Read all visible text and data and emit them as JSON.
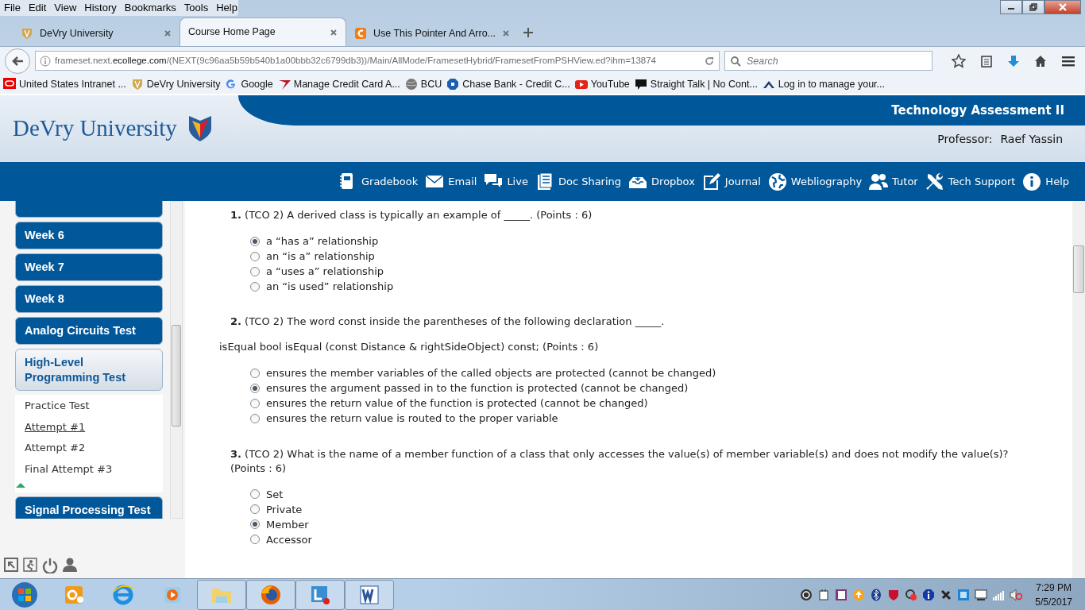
{
  "menu_bar": [
    "File",
    "Edit",
    "View",
    "History",
    "Bookmarks",
    "Tools",
    "Help"
  ],
  "tabs": [
    {
      "label": "DeVry University",
      "selected": false,
      "kind": "shield"
    },
    {
      "label": "Course Home Page",
      "selected": true,
      "kind": "none"
    },
    {
      "label": "Use This Pointer And Arro...",
      "selected": false,
      "kind": "orange"
    }
  ],
  "address": "frameset.next.**ecollege.com**/(NEXT(9c96aa5b59b540b1a00bbb32c6799db3))/Main/AllMode/FramesetHybrid/FramesetFromPSHView.ed?ihm=13874",
  "search": {
    "placeholder": "Search"
  },
  "bookmarks": [
    {
      "label": "United States Intranet ...",
      "kind": "oracle"
    },
    {
      "label": "DeVry University",
      "kind": "shield"
    },
    {
      "label": "Google",
      "kind": "google"
    },
    {
      "label": "Manage Credit Card A...",
      "kind": "swoosh"
    },
    {
      "label": "BCU",
      "kind": "globe"
    },
    {
      "label": "Chase Bank - Credit C...",
      "kind": "chase"
    },
    {
      "label": "YouTube",
      "kind": "youtube"
    },
    {
      "label": "Straight Talk | No Cont...",
      "kind": "bubble"
    },
    {
      "label": "Log in to manage your...",
      "kind": "roof"
    }
  ],
  "site": {
    "logo": "DeVry University",
    "course_title": "Technology Assessment II",
    "professor_label": "Professor:",
    "professor_name": "Raef Yassin"
  },
  "nav_links": [
    {
      "label": "Gradebook",
      "kind": "book"
    },
    {
      "label": "Email",
      "kind": "mail"
    },
    {
      "label": "Live",
      "kind": "chat"
    },
    {
      "label": "Doc Sharing",
      "kind": "doc"
    },
    {
      "label": "Dropbox",
      "kind": "dropbox"
    },
    {
      "label": "Journal",
      "kind": "journal"
    },
    {
      "label": "Webliography",
      "kind": "globe"
    },
    {
      "label": "Tutor",
      "kind": "people"
    },
    {
      "label": "Tech Support",
      "kind": "tools"
    },
    {
      "label": "Help",
      "kind": "info"
    }
  ],
  "sidebar": {
    "items": [
      {
        "label": "Week 6",
        "expanded": false
      },
      {
        "label": "Week 7",
        "expanded": false
      },
      {
        "label": "Week 8",
        "expanded": false
      },
      {
        "label": "Analog Circuits Test",
        "expanded": false
      },
      {
        "label": "High-Level Programming Test",
        "expanded": true,
        "children": [
          {
            "label": "Practice Test",
            "selected": false
          },
          {
            "label": "Attempt #1",
            "selected": true
          },
          {
            "label": "Attempt #2",
            "selected": false
          },
          {
            "label": "Final Attempt #3",
            "selected": false
          }
        ]
      },
      {
        "label": "Signal Processing Test",
        "expanded": false
      }
    ]
  },
  "questions": [
    {
      "number": "1.",
      "text": "(TCO 2) A derived class is typically an example of _____. (Points : 6)",
      "options": [
        {
          "label": "a “has a” relationship",
          "selected": true
        },
        {
          "label": "an “is a” relationship",
          "selected": false
        },
        {
          "label": "a “uses a” relationship",
          "selected": false
        },
        {
          "label": "an “is used” relationship",
          "selected": false
        }
      ]
    },
    {
      "number": "2.",
      "text": "(TCO 2) The word const inside the parentheses of the following declaration _____.",
      "detail": "isEqual bool isEqual (const Distance & rightSideObject) const; (Points : 6)",
      "options": [
        {
          "label": "ensures the member variables of the called objects are protected (cannot be changed)",
          "selected": false
        },
        {
          "label": "ensures the argument passed in to the function is protected (cannot be changed)",
          "selected": true
        },
        {
          "label": "ensures the return value of the function is protected (cannot be changed)",
          "selected": false
        },
        {
          "label": "ensures the return value is routed to the proper variable",
          "selected": false
        }
      ]
    },
    {
      "number": "3.",
      "text": "(TCO 2) What is the name of a member function of a class that only accesses the value(s) of member variable(s) and does not modify the value(s)? (Points : 6)",
      "options": [
        {
          "label": "Set",
          "selected": false
        },
        {
          "label": "Private",
          "selected": false
        },
        {
          "label": "Member",
          "selected": true
        },
        {
          "label": "Accessor",
          "selected": false
        }
      ]
    }
  ],
  "taskbar": {
    "time": "7:29 PM",
    "date": "5/5/2017"
  }
}
